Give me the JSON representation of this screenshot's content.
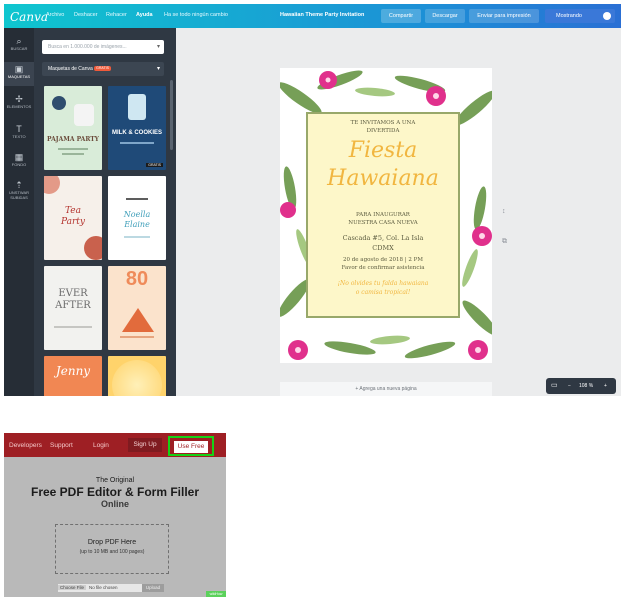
{
  "canva": {
    "topbar": {
      "logo": "Canva",
      "menu": [
        "Archivo",
        "Deshacer",
        "Rehacer",
        "Ayuda",
        "Ha se todo ningún cambio"
      ],
      "doc_title": "Hawaiian Theme Party Invitation",
      "share": "Compartir",
      "download": "Descargar",
      "print": "Enviar para impresión",
      "showing": "Mostrando"
    },
    "sidebar": [
      {
        "icon": "search-icon",
        "glyph": "⌕",
        "label": "BUSCAR"
      },
      {
        "icon": "layouts-icon",
        "glyph": "▣",
        "label": "MAQUETAS"
      },
      {
        "icon": "elements-icon",
        "glyph": "✢",
        "label": "ELEMENTOS"
      },
      {
        "icon": "text-icon",
        "glyph": "T",
        "label": "TEXTO"
      },
      {
        "icon": "background-icon",
        "glyph": "▦",
        "label": "FONDO"
      },
      {
        "icon": "upload-icon",
        "glyph": "⇡",
        "label": "UNSTWAR SUBIDAS"
      }
    ],
    "panel": {
      "search_placeholder": "Busca en 1.000.000 de imágenes...",
      "dropdown": "Maquetas de Canva",
      "dropdown_badge": "GRATIS",
      "templates": [
        {
          "line1": "PAJAMA PARTY",
          "line2": "",
          "bg": "#d9ecd9",
          "color": "#6a4b3a"
        },
        {
          "line1": "MILK & COOKIES",
          "line2": "",
          "bg": "#1f4a78",
          "color": "#ffffff"
        },
        {
          "line1": "Tea",
          "line2": "Party",
          "bg": "#f6f0ea",
          "color": "#b4342f"
        },
        {
          "line1": "Noella",
          "line2": "Elaine",
          "bg": "#ffffff",
          "color": "#3f9fba"
        },
        {
          "line1": "EVER",
          "line2": "AFTER",
          "bg": "#f2f2ef",
          "color": "#6c6c6c"
        },
        {
          "line1": "80",
          "line2": "",
          "bg": "#fbe3cc",
          "color": "#ef8b5a"
        },
        {
          "line1": "Jenny",
          "line2": "",
          "bg": "#f18753",
          "color": "#ffffff"
        },
        {
          "line1": "",
          "line2": "",
          "bg": "#ffd36b",
          "color": "#ffffff"
        }
      ],
      "gratis_tag": "GRATIS"
    },
    "invitation": {
      "top1": "TE INVITAMOS A UNA",
      "top2": "DIVERTIDA",
      "script1": "Fiesta",
      "script2": "Hawaiana",
      "mid1": "PARA INAUGURAR",
      "mid2": "NUESTRA CASA NUEVA",
      "addr1": "Cascada #5, Col. La Isla",
      "addr2": "CDMX",
      "date": "20 de agosto de 2018 | 2 PM",
      "rsvp": "Favor de confirmar asistencia",
      "note1": "¡No olvides tu falda hawaiana",
      "note2": "o camisa tropical!"
    },
    "add_page": "+ Agrega una nueva página",
    "zoom": "108 %"
  },
  "pdf": {
    "nav": [
      "Developers",
      "Support",
      "Login"
    ],
    "signup": "Sign Up",
    "use_free": "Use Free",
    "the_original": "The Original",
    "headline": "Free PDF Editor & Form Filler",
    "online": "Online",
    "drop": "Drop PDF Here",
    "drop_sub": "(up to 10 MB and 100 pages)",
    "choose": "Choose File",
    "no_file": "No file chosen",
    "upload": "Upload",
    "watermark": "wikiHow"
  },
  "colors": {
    "canva_gradient_start": "#0fc6cf",
    "canva_gradient_end": "#2a6fd4",
    "pdf_nav": "#9e1f24",
    "highlight": "#16d116",
    "script_gold": "#f1b640"
  }
}
